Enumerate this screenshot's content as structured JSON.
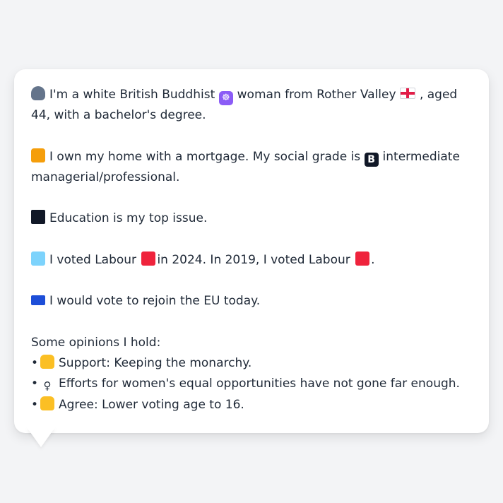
{
  "profile": {
    "intro_a": "I'm a white British Buddhist",
    "intro_b": "woman from Rother Valley",
    "intro_c": ", aged 44, with a bachelor's degree.",
    "home_a": "I own my home with a mortgage. My social grade is",
    "home_b": "intermediate managerial/professional.",
    "grade_letter": "B",
    "issue": "Education is my top issue.",
    "vote_a": "I voted Labour",
    "vote_b": "in 2024. In 2019, I voted Labour",
    "vote_c": ".",
    "eu": "I would vote to rejoin the EU today."
  },
  "opinions": {
    "heading": "Some opinions I hold:",
    "items": [
      {
        "icon": "thumbs-up-icon",
        "text": "Support: Keeping the monarchy."
      },
      {
        "icon": "female-sign-icon",
        "glyph": "♀",
        "text": "Efforts for women's equal opportunities have not gone far enough."
      },
      {
        "icon": "thumbs-up-icon",
        "text": "Agree: Lower voting age to 16."
      }
    ]
  },
  "colors": {
    "background": "#f3f4f6",
    "card": "#ffffff",
    "text": "#1f2937",
    "labour_red": "#ef233c"
  }
}
